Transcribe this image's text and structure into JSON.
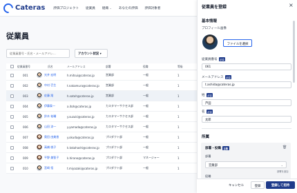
{
  "app": {
    "logo_text": "Cateras"
  },
  "nav": [
    {
      "label": "評価プロジェクト"
    },
    {
      "label": "従業員"
    },
    {
      "label": "組織"
    },
    {
      "label": "あなたの評価"
    },
    {
      "label": "評価対象者"
    }
  ],
  "page": {
    "title": "従業員"
  },
  "search": {
    "placeholder": "従業員番号・氏名・メールアドレ..."
  },
  "filter": {
    "label": "アカウント状況",
    "caret": "▾"
  },
  "table": {
    "headers": [
      "従業員番号",
      "氏名",
      "メールアドレス",
      "部署",
      "役職",
      "等級"
    ],
    "rows": [
      {
        "num": "001",
        "name": "光井 宏明",
        "email": "h.mitsui@cateras.jp",
        "dept": "営業部",
        "role": "一般",
        "grade": "1",
        "gender": "m"
      },
      {
        "num": "002",
        "name": "中村 壱生",
        "email": "t.nakamura@cateras.jp",
        "dept": "営業部",
        "role": "一般",
        "grade": "1",
        "gender": "m"
      },
      {
        "num": "003",
        "name": "佐藤 翔",
        "email": "h.satoh@cateras.jp",
        "dept": "営業部",
        "role": "一般",
        "grade": "1",
        "gender": "m"
      },
      {
        "num": "004",
        "name": "伊藤泰一",
        "email": "a.itoh@cateras.jp",
        "dept": "カスタマーサクセス部",
        "role": "一般",
        "grade": "1",
        "gender": "m"
      },
      {
        "num": "005",
        "name": "鈴木 祐輔",
        "email": "y.suzuki@cateras.jp",
        "dept": "カスタマーサクセス部",
        "role": "一般",
        "grade": "1",
        "gender": "m"
      },
      {
        "num": "006",
        "name": "山田 涼一",
        "email": "y.yamada@cateras.jp",
        "dept": "カスタマーサクセス部",
        "role": "一般",
        "grade": "1",
        "gender": "m"
      },
      {
        "num": "007",
        "name": "奥田 由美香",
        "email": "y.okuda@cateras.jp",
        "dept": "プロダクト部",
        "role": "一般",
        "grade": "1",
        "gender": "f"
      },
      {
        "num": "008",
        "name": "高橋 桃子",
        "email": "k.takahashi@cateras.jp",
        "dept": "プロダクト部",
        "role": "一般",
        "grade": "1",
        "gender": "f"
      },
      {
        "num": "009",
        "name": "平野 美智子",
        "email": "k.hirano@cateras.jp",
        "dept": "プロダクト部",
        "role": "マネージャー",
        "grade": "1",
        "gender": "f"
      },
      {
        "num": "010",
        "name": "宮崎 悟",
        "email": "t.miyazaki@cateras.jp",
        "dept": "プロダクト部",
        "role": "一般",
        "grade": "1",
        "gender": "m"
      }
    ]
  },
  "drawer": {
    "title": "従業員を登録",
    "close": "×",
    "section_basic": "基本情報",
    "photo_label": "プロフィール画像",
    "file_button": "ファイルを選択",
    "emp_num_label": "従業員番号",
    "emp_num_value": "061",
    "email_label": "メールアドレス",
    "email_value": "t.ashida@cateras.jp",
    "last_name_label": "姓",
    "last_name_value": "芦田",
    "first_name_label": "名",
    "first_name_value": "太郎",
    "required": "必須",
    "section_affiliation": "所属",
    "affiliation_block_title": "部署・役職",
    "affiliation_tag": "主務",
    "delete_icon": "🗑",
    "dept_label": "部署",
    "dept_value": "営業部",
    "dept_hint": "部署を追加",
    "role_label": "役職",
    "cancel": "キャンセル",
    "register": "登録",
    "register_invite": "登録して招待"
  },
  "colors": {
    "accent": "#1e3a8a",
    "link": "#2563eb"
  }
}
